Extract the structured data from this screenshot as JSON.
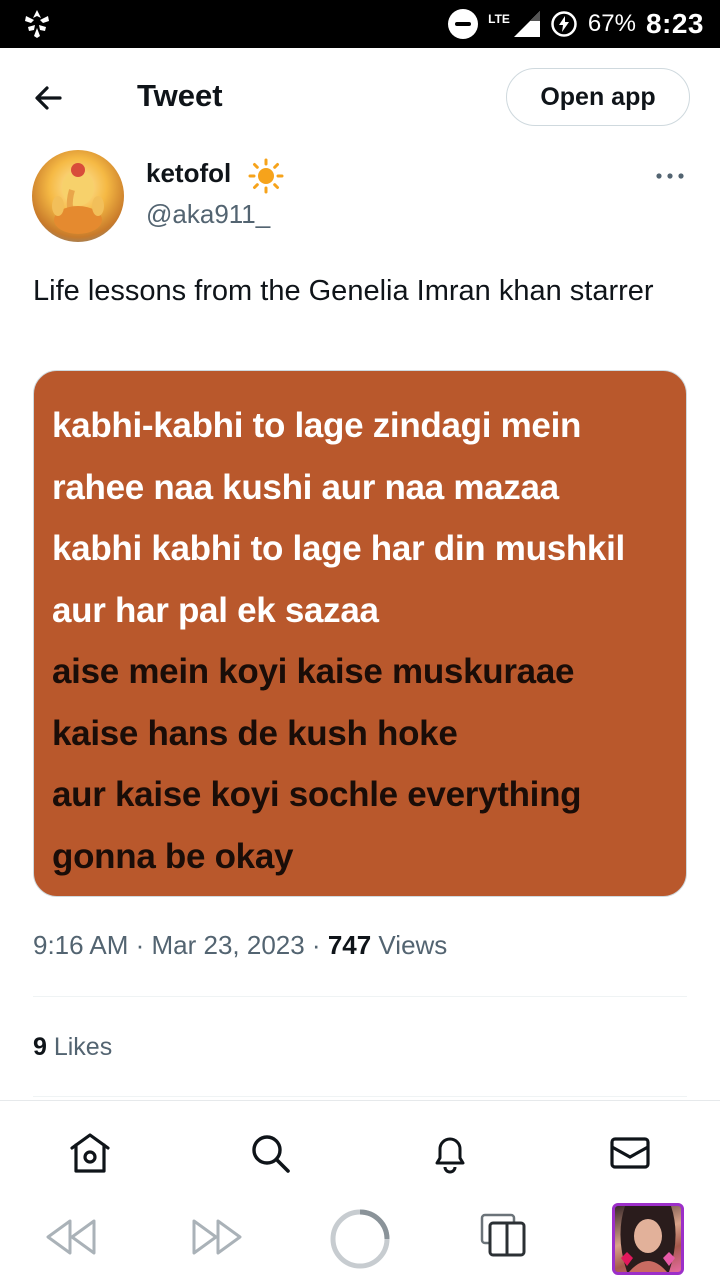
{
  "status_bar": {
    "network": "LTE",
    "battery_percent": "67%",
    "time": "8:23"
  },
  "header": {
    "title": "Tweet",
    "open_app_label": "Open app"
  },
  "tweet": {
    "author_name": "ketofol",
    "handle": "@aka911_",
    "text": "Life lessons from the Genelia Imran khan starrer",
    "image_lines": [
      "kabhi-kabhi to lage zindagi mein",
      "rahee naa kushi aur naa mazaa",
      "kabhi kabhi to lage har din mushkil",
      "aur har pal ek sazaa",
      "aise mein koyi kaise muskuraae",
      "kaise hans de kush hoke",
      "aur kaise koyi sochle everything",
      "gonna be okay"
    ],
    "timestamp": "9:16 AM · Mar 23, 2023 · ",
    "views_count": "747",
    "views_label": " Views",
    "likes_count": "9",
    "likes_label": " Likes"
  },
  "colors": {
    "image_background": "#b9582c",
    "profile_border": "#9c2fc9",
    "secondary_text": "#536471"
  },
  "icons": {
    "back": "arrow-left-icon",
    "verified_sun": "sun-emoji-icon",
    "more": "more-dots-icon",
    "home": "home-icon",
    "search": "search-icon",
    "notifications": "bell-icon",
    "messages": "mail-icon"
  }
}
